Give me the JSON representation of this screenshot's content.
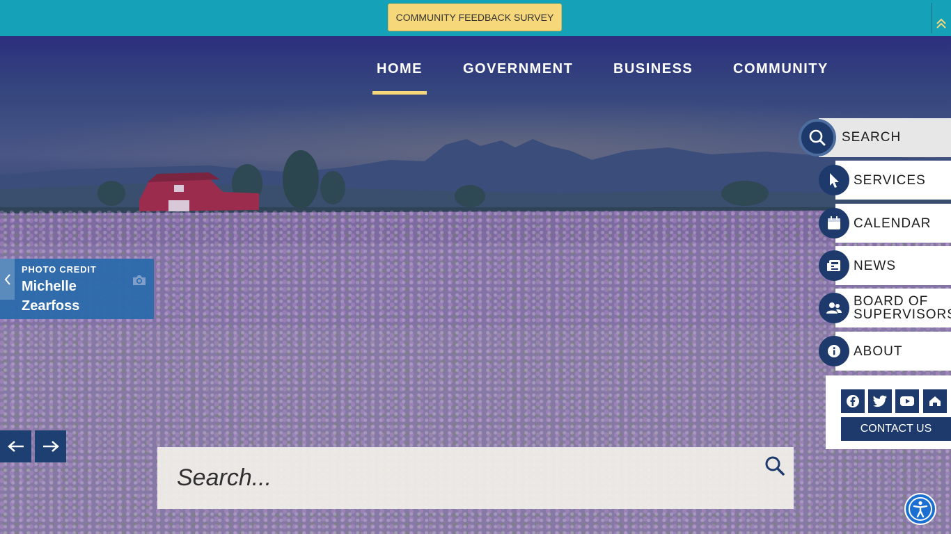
{
  "topbar": {
    "survey_label": "COMMUNITY FEEDBACK SURVEY",
    "collapse_icon": "double-chevron-up-icon"
  },
  "nav": {
    "items": [
      {
        "label": "HOME",
        "active": true
      },
      {
        "label": "GOVERNMENT",
        "active": false
      },
      {
        "label": "BUSINESS",
        "active": false
      },
      {
        "label": "COMMUNITY",
        "active": false
      }
    ]
  },
  "photo_credit": {
    "label": "PHOTO CREDIT",
    "name": "Michelle Zearfoss",
    "icon": "camera-icon"
  },
  "slider": {
    "prev_icon": "arrow-left-icon",
    "next_icon": "arrow-right-icon"
  },
  "search": {
    "placeholder": "Search...",
    "icon": "search-icon"
  },
  "quick_links": {
    "search_label": "SEARCH",
    "items": [
      {
        "label": "SERVICES",
        "icon": "cursor-pointer-icon"
      },
      {
        "label": "CALENDAR",
        "icon": "calendar-icon"
      },
      {
        "label": "NEWS",
        "icon": "newspaper-icon"
      },
      {
        "label": "BOARD OF SUPERVISORS",
        "icon": "users-icon"
      },
      {
        "label": "ABOUT",
        "icon": "info-icon"
      }
    ]
  },
  "social": {
    "icons": [
      "facebook-icon",
      "twitter-icon",
      "youtube-icon",
      "nextdoor-icon"
    ],
    "contact_label": "CONTACT US"
  },
  "accessibility": {
    "icon": "accessibility-icon"
  },
  "colors": {
    "topbar": "#15a1b8",
    "accent_yellow": "#f6d77a",
    "navy": "#1e3a6c",
    "credit_blue": "#2b6aac"
  }
}
